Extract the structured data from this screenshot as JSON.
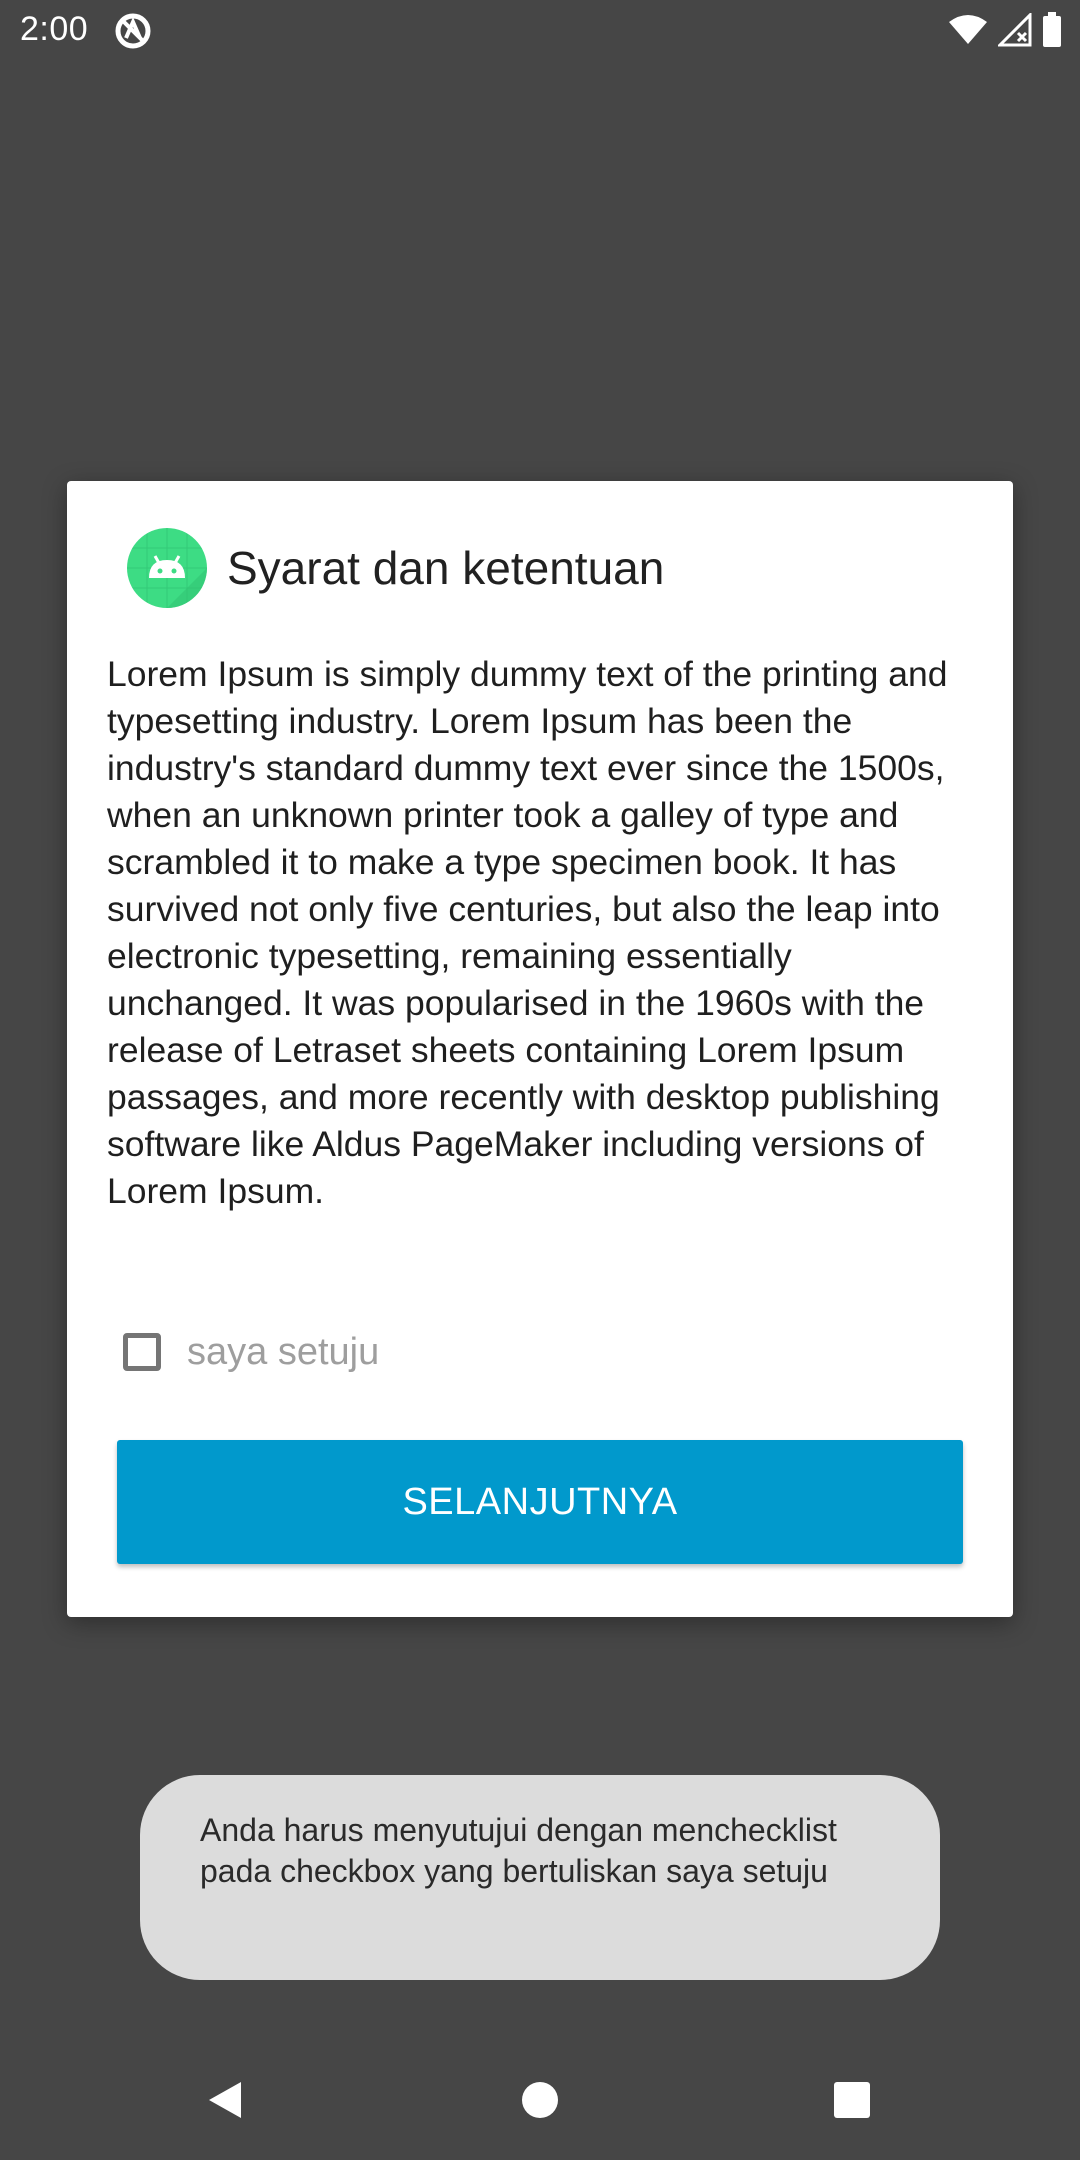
{
  "status_bar": {
    "time": "2:00",
    "icons": [
      "app-notification-icon",
      "wifi-icon",
      "cellular-signal-icon",
      "battery-icon"
    ]
  },
  "dialog": {
    "icon": "android-app-icon",
    "title": "Syarat dan ketentuan",
    "body": "Lorem Ipsum is simply dummy text of the printing and typesetting industry. Lorem Ipsum has been the industry's standard dummy text ever since the 1500s, when an unknown printer took a galley of type and scrambled it to make a type specimen book. It has survived not only five centuries, but also the leap into electronic typesetting, remaining essentially unchanged. It was popularised in the 1960s with the release of Letraset sheets containing Lorem Ipsum passages, and more recently with desktop publishing software like Aldus PageMaker including versions of Lorem Ipsum.",
    "checkbox": {
      "label": "saya setuju",
      "checked": false
    },
    "button_label": "SELANJUTNYA",
    "accent_color": "#0199cc"
  },
  "toast": {
    "message": "Anda harus menyutujui dengan menchecklist pada checkbox yang bertuliskan saya setuju"
  },
  "nav_bar": {
    "buttons": [
      "back-icon",
      "home-icon",
      "recents-icon"
    ]
  }
}
